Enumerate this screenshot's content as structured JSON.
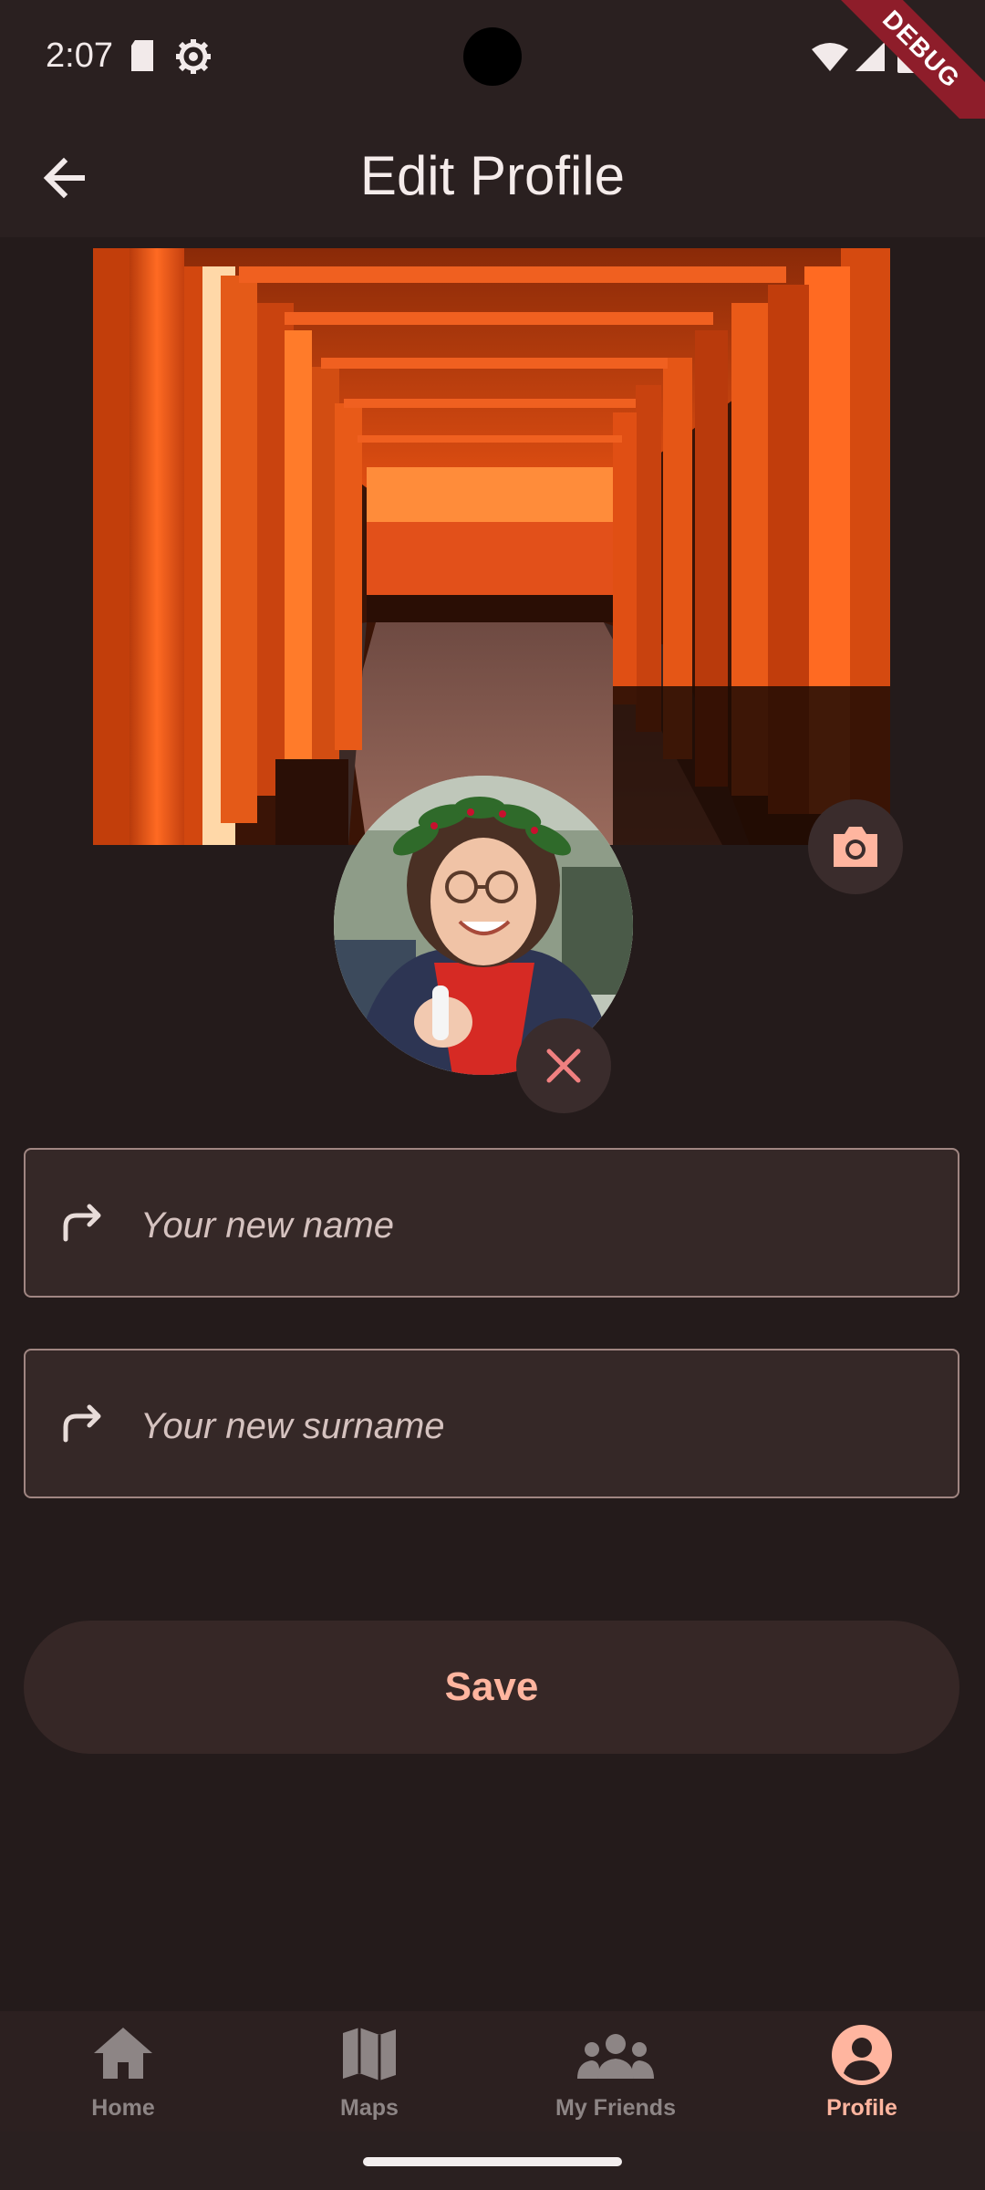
{
  "status_bar": {
    "time": "2:07",
    "debug_label": "DEBUG"
  },
  "app_bar": {
    "title": "Edit Profile"
  },
  "form": {
    "name_placeholder": "Your new name",
    "surname_placeholder": "Your new surname",
    "save_label": "Save"
  },
  "bottom_nav": {
    "items": [
      {
        "label": "Home",
        "icon": "home-icon",
        "active": false
      },
      {
        "label": "Maps",
        "icon": "map-icon",
        "active": false
      },
      {
        "label": "My Friends",
        "icon": "people-icon",
        "active": false
      },
      {
        "label": "Profile",
        "icon": "account-circle-icon",
        "active": true
      }
    ]
  },
  "colors": {
    "background": "#241b1b",
    "surface": "#352827",
    "accent": "#ffb59f",
    "nav_inactive": "#8d8585"
  }
}
